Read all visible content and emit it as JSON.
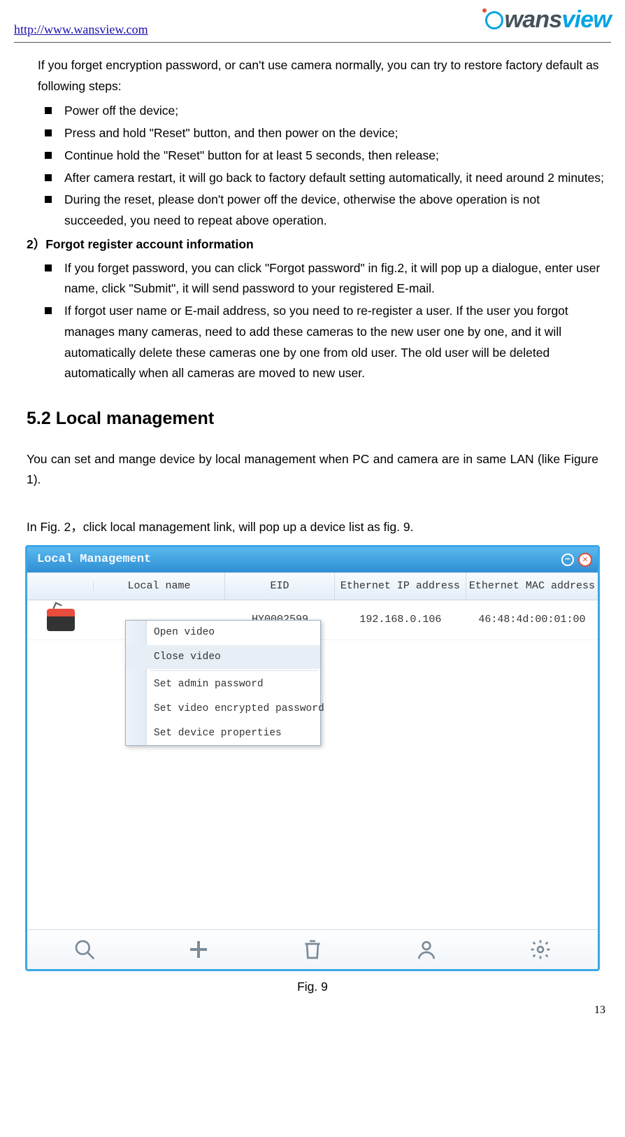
{
  "header": {
    "url": "http://www.wansview.com",
    "brand_part1": "wans",
    "brand_part2": "view"
  },
  "intro": "If you forget encryption password, or can't use camera normally, you can try to restore factory default as following steps:",
  "reset_steps": [
    "Power off the device;",
    "Press and hold \"Reset\" button, and then power on the device;",
    "Continue hold the \"Reset\" button for at least 5 seconds, then release;",
    "After camera restart, it will go back to factory default setting automatically, it need around 2 minutes;",
    "During the reset, please don't power off the device, otherwise the above operation is not succeeded, you need to repeat above operation."
  ],
  "sect2_title": "2）Forgot register account information",
  "sect2_items": [
    "If you forget password, you can click \"Forgot password\" in fig.2, it will pop up a dialogue, enter user name, click \"Submit\", it will send password to your registered E-mail.",
    "If forgot user name or E-mail address, so you need to re-register a user. If the user you forgot manages many cameras, need to add these cameras to the new user one by one, and it will automatically delete these cameras one by one from old user. The old user will be deleted automatically when all cameras are moved to new user."
  ],
  "section_heading": "5.2 Local management",
  "para1": "You can set and mange device by local management when PC and camera are in same LAN (like Figure 1).",
  "para2": "In Fig. 2，click local management link, will pop up a device list as fig. 9.",
  "lm": {
    "title": "Local Management",
    "cols": [
      "",
      "Local name",
      "EID",
      "Ethernet IP address",
      "Ethernet MAC address"
    ],
    "row": {
      "local_name": "",
      "eid": "HY0002599",
      "ip": "192.168.0.106",
      "mac": "46:48:4d:00:01:00"
    },
    "ctx": [
      "Open video",
      "Close video",
      "Set admin password",
      "Set video encrypted password",
      "Set device properties"
    ]
  },
  "fig_caption": "Fig. 9",
  "page_number": "13"
}
